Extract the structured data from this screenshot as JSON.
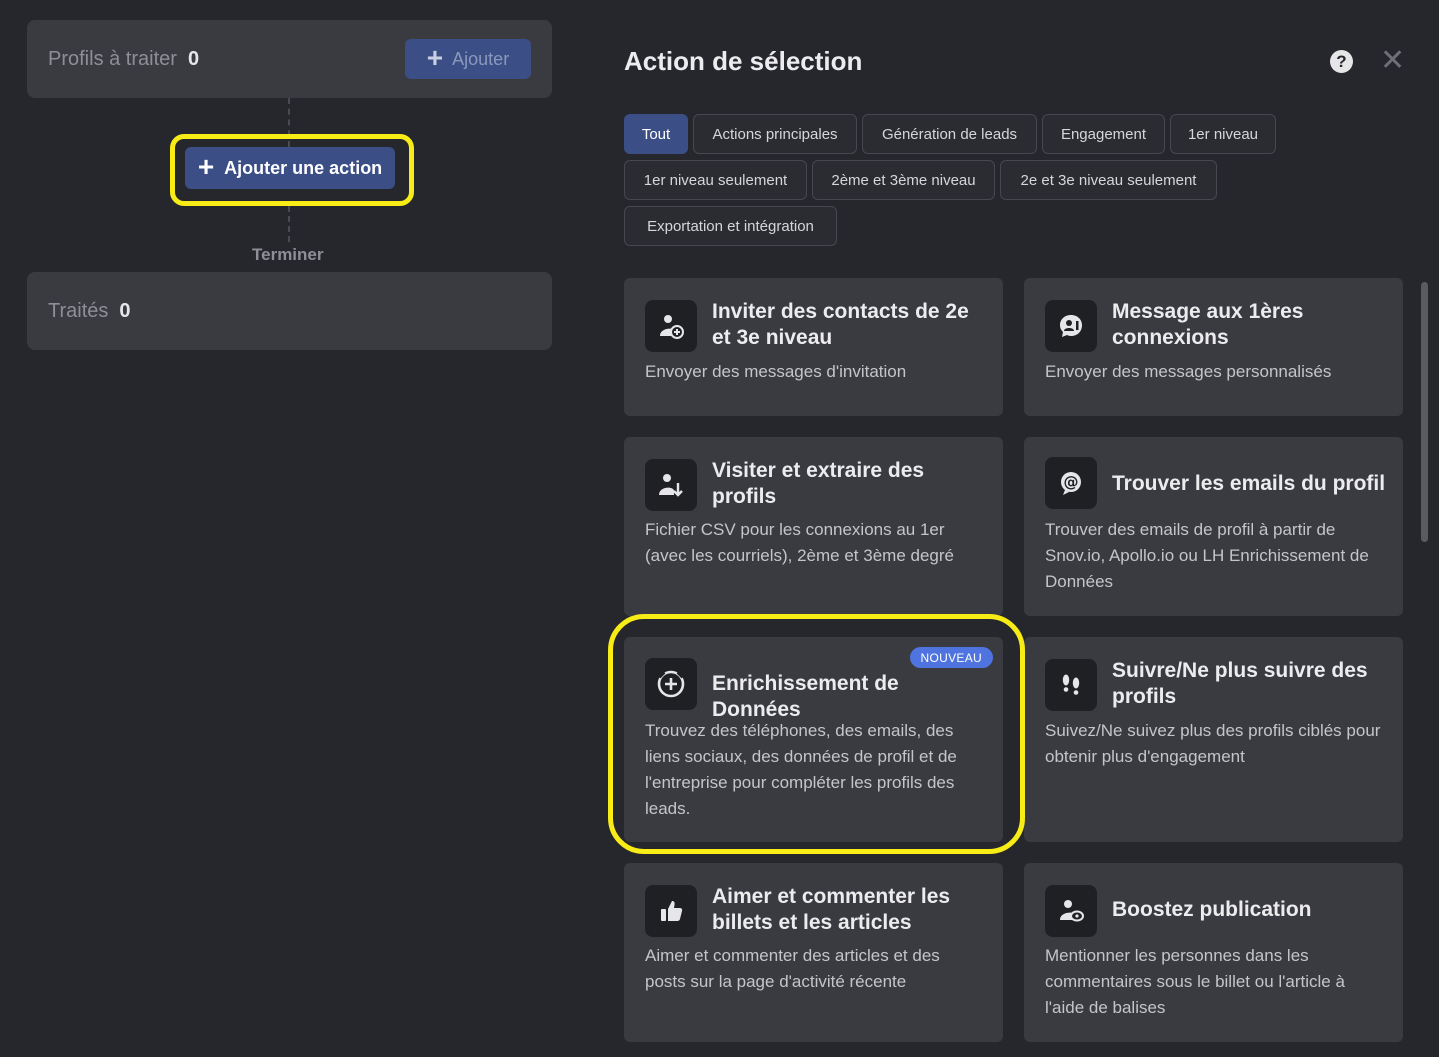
{
  "left": {
    "to_process": {
      "label": "Profils à traiter",
      "count": "0",
      "add_label": "Ajouter"
    },
    "add_action_label": "Ajouter une action",
    "finish_label": "Terminer",
    "processed": {
      "label": "Traités",
      "count": "0"
    }
  },
  "panel": {
    "title": "Action de sélection",
    "help": "?",
    "close": "✕",
    "filters": [
      {
        "label": "Tout",
        "active": true
      },
      {
        "label": "Actions principales"
      },
      {
        "label": "Génération de leads"
      },
      {
        "label": "Engagement"
      },
      {
        "label": "1er niveau"
      },
      {
        "label": "1er niveau seulement"
      },
      {
        "label": "2ème et 3ème niveau"
      },
      {
        "label": "2e et 3e niveau seulement"
      },
      {
        "label": "Exportation et intégration"
      }
    ],
    "cards": [
      {
        "icon": "person-add-icon",
        "title": "Inviter des contacts de 2e et 3e niveau",
        "desc": "Envoyer des messages d'invitation"
      },
      {
        "icon": "message-person-icon",
        "title": "Message aux 1ères connexions",
        "desc": "Envoyer des messages personnalisés"
      },
      {
        "icon": "person-download-icon",
        "title": "Visiter et extraire des profils",
        "desc": "Fichier CSV pour les connexions au 1er (avec les courriels), 2ème et 3ème degré"
      },
      {
        "icon": "at-sign-icon",
        "title": "Trouver les emails du profil",
        "desc": "Trouver des emails de profil à partir de Snov.io, Apollo.io ou LH Enrichissement de Données"
      },
      {
        "icon": "enrich-plus-icon",
        "title": "Enrichissement de Données",
        "desc": "Trouvez des téléphones, des emails, des liens sociaux, des données de profil et de l'entreprise pour compléter les profils des leads.",
        "badge": "NOUVEAU"
      },
      {
        "icon": "footsteps-icon",
        "title": "Suivre/Ne plus suivre des profils",
        "desc": "Suivez/Ne suivez plus des profils ciblés pour obtenir plus d'engagement"
      },
      {
        "icon": "thumbs-up-icon",
        "title": "Aimer et commenter les billets et les articles",
        "desc": "Aimer et commenter des articles et des posts sur la page d'activité récente"
      },
      {
        "icon": "boost-person-icon",
        "title": "Boostez publication",
        "desc": "Mentionner les personnes dans les commentaires sous le billet ou l'article à l'aide de balises"
      }
    ]
  },
  "colors": {
    "background": "#26272c",
    "card": "#3a3b41",
    "accent": "#3b4f86",
    "highlight": "#f7ec16",
    "badge": "#4f74e0"
  }
}
